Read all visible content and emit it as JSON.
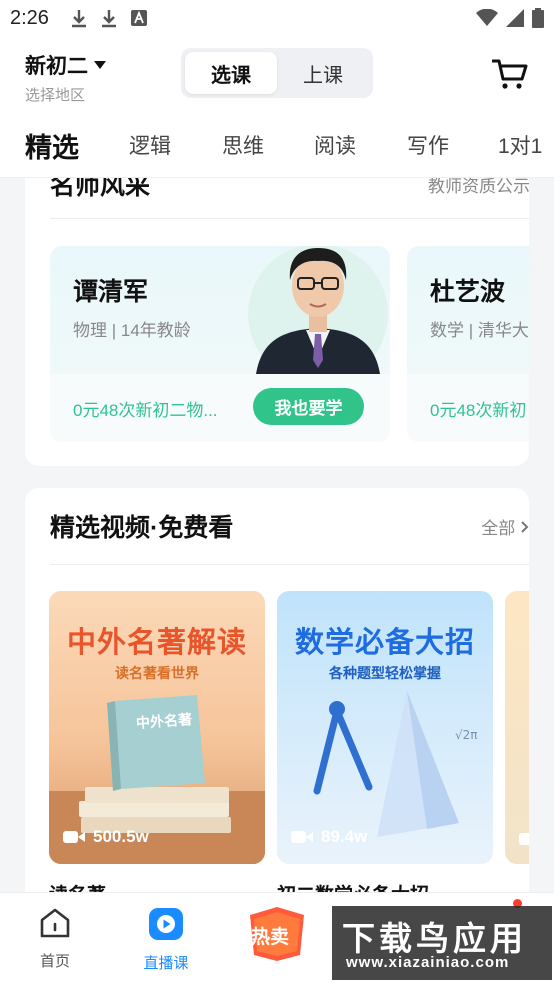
{
  "status_bar": {
    "time": "2:26"
  },
  "header": {
    "grade": "新初二",
    "region": "选择地区",
    "mode_tabs": [
      "选课",
      "上课"
    ],
    "tabs": [
      "精选",
      "逻辑",
      "思维",
      "阅读",
      "写作",
      "1对1"
    ]
  },
  "teachers_section": {
    "title": "名师风采",
    "link": "教师资质公示",
    "cards": [
      {
        "name": "谭清军",
        "meta": "物理 | 14年教龄",
        "course": "0元48次新初二物...",
        "button": "我也要学"
      },
      {
        "name": "杜艺波",
        "meta": "数学 | 清华大",
        "course": "0元48次新初"
      }
    ]
  },
  "videos_section": {
    "title": "精选视频·免费看",
    "link": "全部",
    "videos": [
      {
        "title": "中外名著解读",
        "subtitle": "读名著看世界",
        "book_text": "中外名著",
        "count": "500.5w",
        "caption": "读名著"
      },
      {
        "title": "数学必备大招",
        "subtitle": "各种题型轻松掌握",
        "count": "89.4w",
        "caption": "初二数学必备大招"
      }
    ]
  },
  "bottom_nav": {
    "items": [
      "首页",
      "直播课",
      "热卖"
    ]
  },
  "watermark": {
    "title": "下载鸟应用",
    "url": "www.xiazainiao.com"
  },
  "colors": {
    "accent_green": "#30c48b",
    "nav_active": "#1a8cff"
  }
}
